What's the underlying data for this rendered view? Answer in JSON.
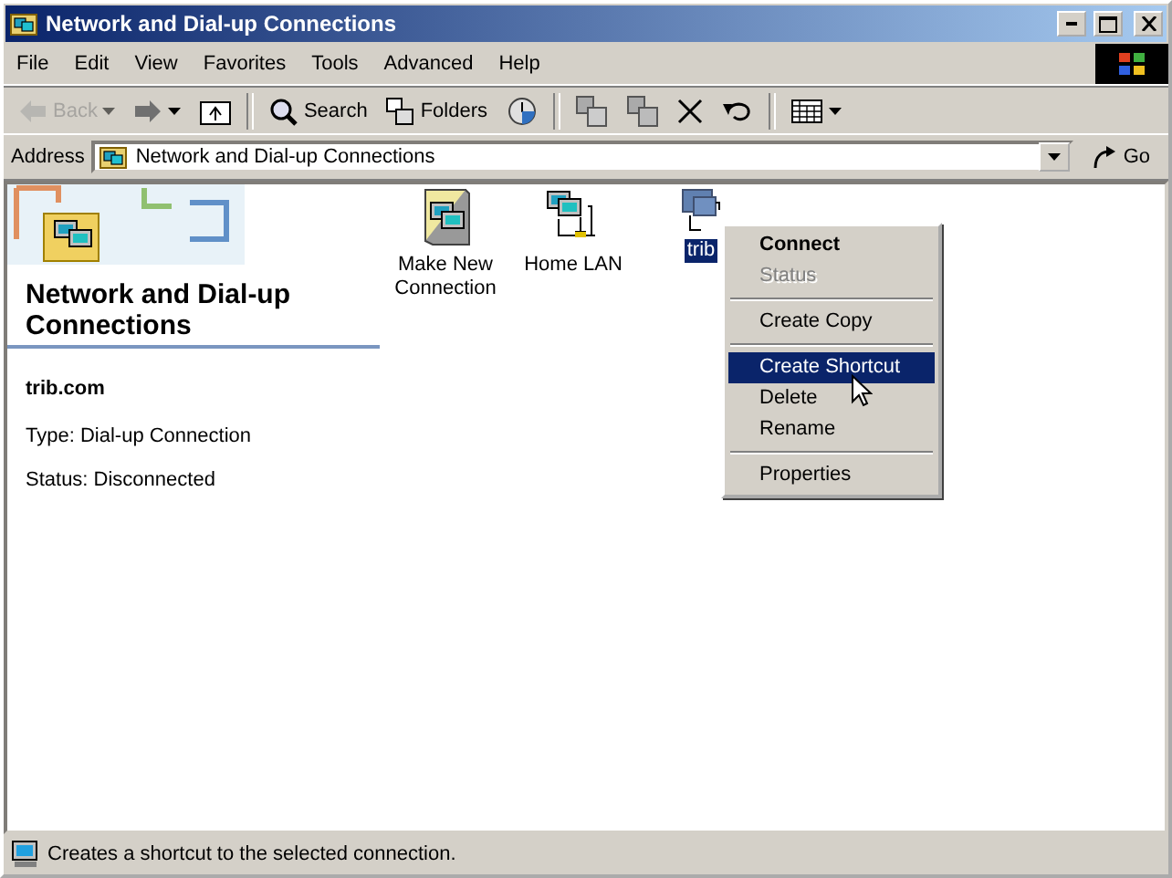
{
  "window": {
    "title": "Network and Dial-up Connections"
  },
  "menu_bar": [
    "File",
    "Edit",
    "View",
    "Favorites",
    "Tools",
    "Advanced",
    "Help"
  ],
  "toolbar": [
    {
      "kind": "button",
      "label": "Back",
      "disabled": true,
      "dropdown": true
    },
    {
      "kind": "button",
      "disabled": false,
      "dropdown": true
    },
    {
      "kind": "button",
      "disabled": false
    },
    {
      "kind": "separator"
    },
    {
      "kind": "button",
      "label": "Search",
      "disabled": false
    },
    {
      "kind": "button",
      "label": "Folders",
      "disabled": false
    },
    {
      "kind": "button",
      "disabled": false
    },
    {
      "kind": "separator"
    },
    {
      "kind": "button",
      "disabled": false
    },
    {
      "kind": "button",
      "disabled": false
    },
    {
      "kind": "button",
      "disabled": false
    },
    {
      "kind": "button",
      "disabled": false
    },
    {
      "kind": "separator"
    },
    {
      "kind": "button",
      "disabled": false,
      "dropdown": true
    }
  ],
  "address_bar": {
    "label": "Address",
    "value": "Network and Dial-up Connections",
    "go": "Go"
  },
  "info_pane": {
    "heading": "Network and Dial-up Connections",
    "name": "trib.com",
    "lines": [
      "Type: Dial-up Connection",
      "Status: Disconnected"
    ]
  },
  "items": [
    {
      "label": "Make New Connection",
      "selected": false
    },
    {
      "label": "Home LAN",
      "selected": false
    },
    {
      "label": "trib",
      "selected": true
    }
  ],
  "context_menu": [
    {
      "kind": "item",
      "label": "Connect",
      "default": true,
      "selected": false
    },
    {
      "kind": "item",
      "label": "Status",
      "disabled": true,
      "selected": false
    },
    {
      "kind": "separator"
    },
    {
      "kind": "item",
      "label": "Create Copy",
      "selected": false
    },
    {
      "kind": "separator"
    },
    {
      "kind": "item",
      "label": "Create Shortcut",
      "selected": true
    },
    {
      "kind": "item",
      "label": "Delete",
      "selected": false
    },
    {
      "kind": "item",
      "label": "Rename",
      "selected": false
    },
    {
      "kind": "separator"
    },
    {
      "kind": "item",
      "label": "Properties",
      "selected": false
    }
  ],
  "status_bar": "Creates a shortcut to the selected connection."
}
